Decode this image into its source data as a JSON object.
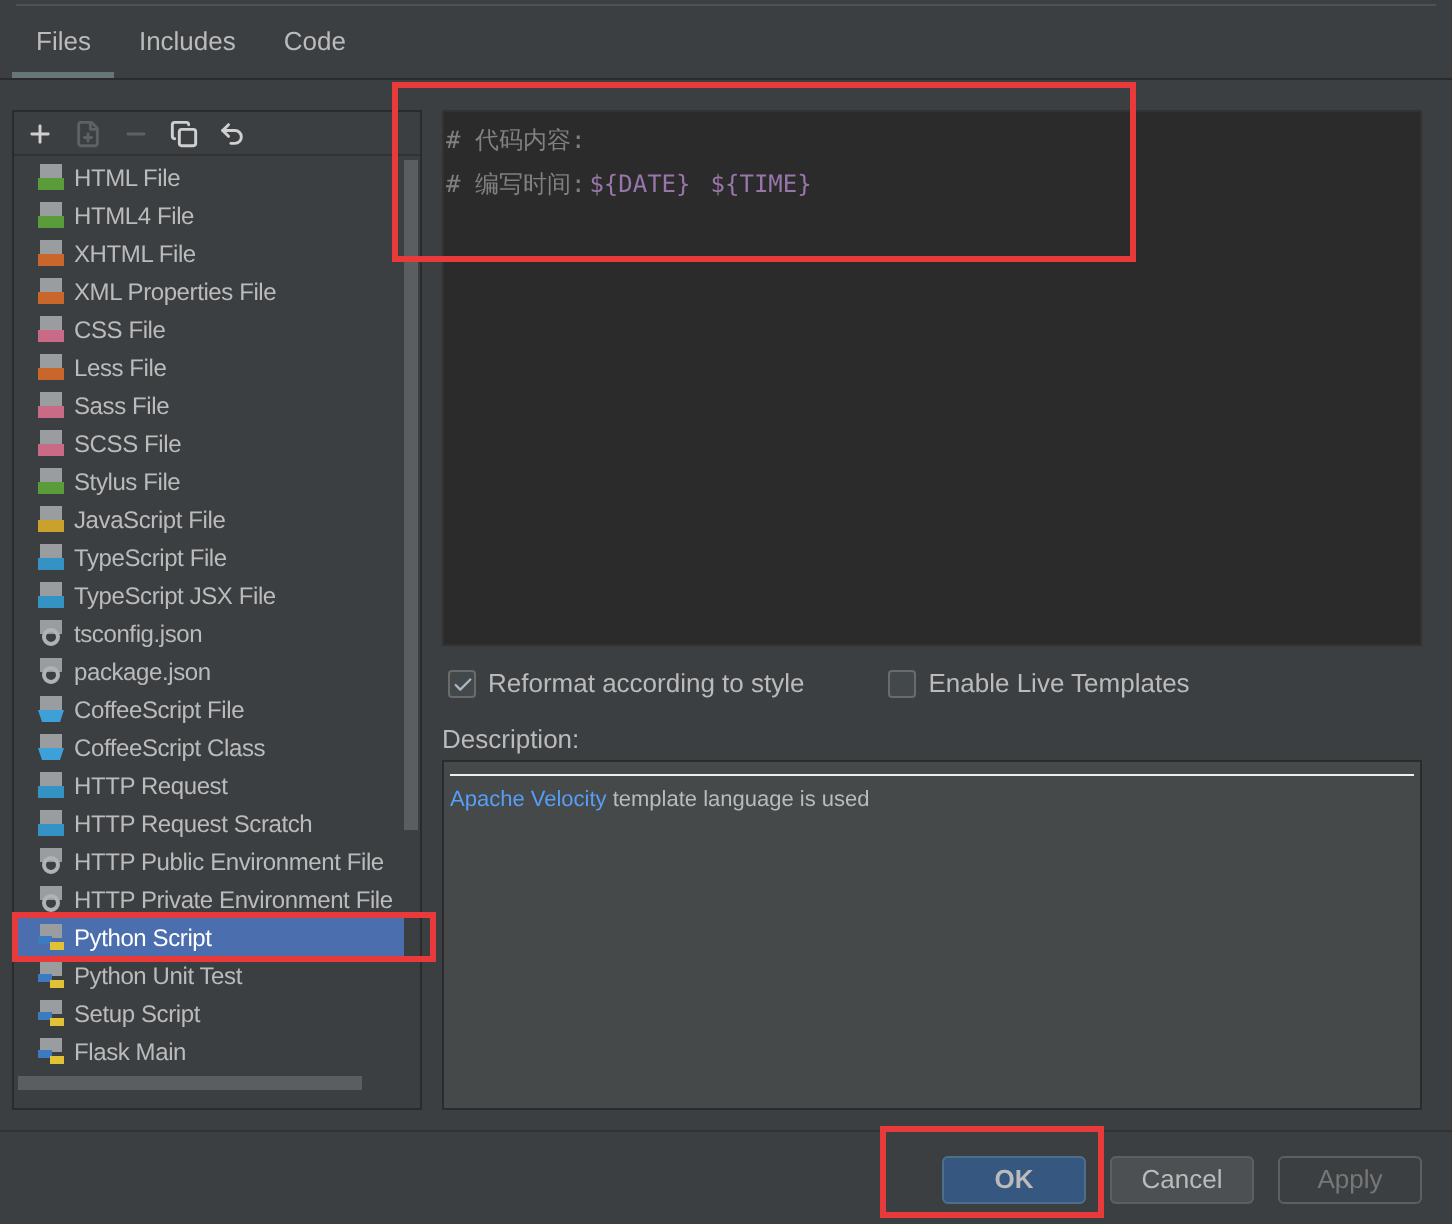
{
  "tabs": [
    {
      "label": "Files",
      "selected": true
    },
    {
      "label": "Includes",
      "selected": false
    },
    {
      "label": "Code",
      "selected": false
    }
  ],
  "toolbar": [
    {
      "kind": "add",
      "disabled": false
    },
    {
      "kind": "add-file",
      "disabled": true
    },
    {
      "kind": "remove",
      "disabled": true
    },
    {
      "kind": "copy",
      "disabled": false
    },
    {
      "kind": "reset",
      "disabled": false
    }
  ],
  "templates": [
    {
      "label": "HTML File",
      "kind": "badge",
      "color": "#5a9b3a",
      "selected": false
    },
    {
      "label": "HTML4 File",
      "kind": "badge",
      "color": "#5a9b3a",
      "selected": false
    },
    {
      "label": "XHTML File",
      "kind": "badge",
      "color": "#c9662b",
      "selected": false
    },
    {
      "label": "XML Properties File",
      "kind": "badge",
      "color": "#c9662b",
      "selected": false
    },
    {
      "label": "CSS File",
      "kind": "badge",
      "color": "#c96b86",
      "selected": false
    },
    {
      "label": "Less File",
      "kind": "badge",
      "color": "#c9662b",
      "selected": false
    },
    {
      "label": "Sass File",
      "kind": "badge",
      "color": "#c96b86",
      "selected": false
    },
    {
      "label": "SCSS File",
      "kind": "badge",
      "color": "#c96b86",
      "selected": false
    },
    {
      "label": "Stylus File",
      "kind": "badge",
      "color": "#5a9b3a",
      "selected": false
    },
    {
      "label": "JavaScript File",
      "kind": "badge",
      "color": "#c9a12b",
      "selected": false
    },
    {
      "label": "TypeScript File",
      "kind": "badge",
      "color": "#3592c4",
      "selected": false
    },
    {
      "label": "TypeScript JSX File",
      "kind": "badge",
      "color": "#3592c4",
      "selected": false
    },
    {
      "label": "tsconfig.json",
      "kind": "gear",
      "selected": false
    },
    {
      "label": "package.json",
      "kind": "gear",
      "selected": false
    },
    {
      "label": "CoffeeScript File",
      "kind": "coffee",
      "selected": false
    },
    {
      "label": "CoffeeScript Class",
      "kind": "coffee",
      "selected": false
    },
    {
      "label": "HTTP Request",
      "kind": "badge",
      "color": "#3592c4",
      "selected": false
    },
    {
      "label": "HTTP Request Scratch",
      "kind": "badge",
      "color": "#3592c4",
      "selected": false
    },
    {
      "label": "HTTP Public Environment File",
      "kind": "gear",
      "selected": false
    },
    {
      "label": "HTTP Private Environment File",
      "kind": "gear",
      "selected": false
    },
    {
      "label": "Python Script",
      "kind": "python",
      "selected": true
    },
    {
      "label": "Python Unit Test",
      "kind": "python",
      "selected": false
    },
    {
      "label": "Setup Script",
      "kind": "python",
      "selected": false
    },
    {
      "label": "Flask Main",
      "kind": "python",
      "selected": false
    }
  ],
  "editor": {
    "lines": [
      [
        {
          "kind": "comment",
          "text": "# 代码内容:"
        }
      ],
      [
        {
          "kind": "comment",
          "text": "# 编写时间:"
        },
        {
          "kind": "variable",
          "text": "${DATE}"
        },
        {
          "kind": "variable",
          "text": "${TIME}"
        }
      ]
    ]
  },
  "options": [
    {
      "label": "Reformat according to style",
      "checked": true
    },
    {
      "label": "Enable Live Templates",
      "checked": false
    }
  ],
  "description": {
    "label": "Description:",
    "link": "Apache Velocity",
    "text": "template language is used"
  },
  "buttons": [
    {
      "label": "OK",
      "kind": "default",
      "disabled": false
    },
    {
      "label": "Cancel",
      "kind": "normal",
      "disabled": false
    },
    {
      "label": "Apply",
      "kind": "normal",
      "disabled": true
    }
  ]
}
